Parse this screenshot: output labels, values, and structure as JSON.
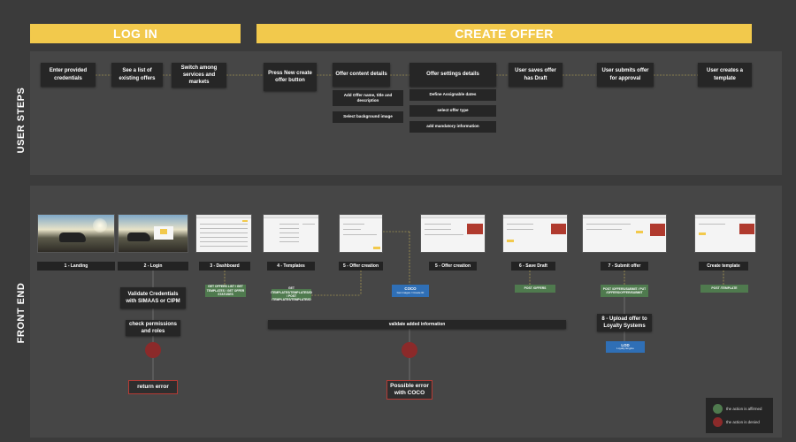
{
  "banners": {
    "login": "LOG IN",
    "create_offer": "CREATE OFFER"
  },
  "lanes": {
    "user_steps": "USER STEPS",
    "front_end": "FRONT END"
  },
  "user_steps": {
    "enter_credentials": "Enter provided credentials",
    "see_offers": "See a list of existing offers",
    "switch_services": "Switch among services and markets",
    "press_new": "Press New create offer button",
    "content_details": "Offer content details",
    "settings_details": "Offer settings details",
    "saves_draft": "User saves offer has Draft",
    "submits_approval": "User submits offer for approval",
    "creates_template": "User creates a template",
    "add_name": "Add Offer name, title and description",
    "select_bg": "Select background image",
    "define_dates": "Define Assignable dates",
    "select_type": "select offer type",
    "add_mandatory": "add mandatory information"
  },
  "front_end": {
    "steps": [
      "1 - Landing",
      "2 - Login",
      "3 - Dashboard",
      "4 - Templates",
      "5 - Offer creation",
      "5 - Offer creation",
      "6 - Save Draft",
      "7 - Submit offer",
      "Create template"
    ],
    "validate_credentials": "Validate Credentials with SIMAAS or CIPM",
    "check_permissions": "check permissions and roles",
    "return_error": "return error",
    "validate_info": "validate added information",
    "possible_error": "Possible error with COCO",
    "upload_offer": "8 - Upload offer to Loyalty Systems",
    "api_dashboard": "GET OFFERS LIST / GET TEMPLATES / GET OFFER STATUSES",
    "api_templates": "GET /TEMPLATES/TEMPLATES/ID / POST /TEMPLATES/TEMPLATE/ID",
    "api_draft": "POST /OFFERS",
    "api_submit": "POST /OFFERS/SUBMIT / PUT /OFFERS/OFFER/SUBMIT",
    "api_template": "POST /TEMPLATE",
    "coco_title": "COCO",
    "coco_sub": "Get images / Create ID",
    "lod_title": "LOD",
    "lod_sub": "Loyalty Engine"
  },
  "legend": {
    "affirmed": "the action is affirmed",
    "denied": "the action is denied",
    "affirmed_color": "#4f7a4e",
    "denied_color": "#8b2a2a"
  }
}
